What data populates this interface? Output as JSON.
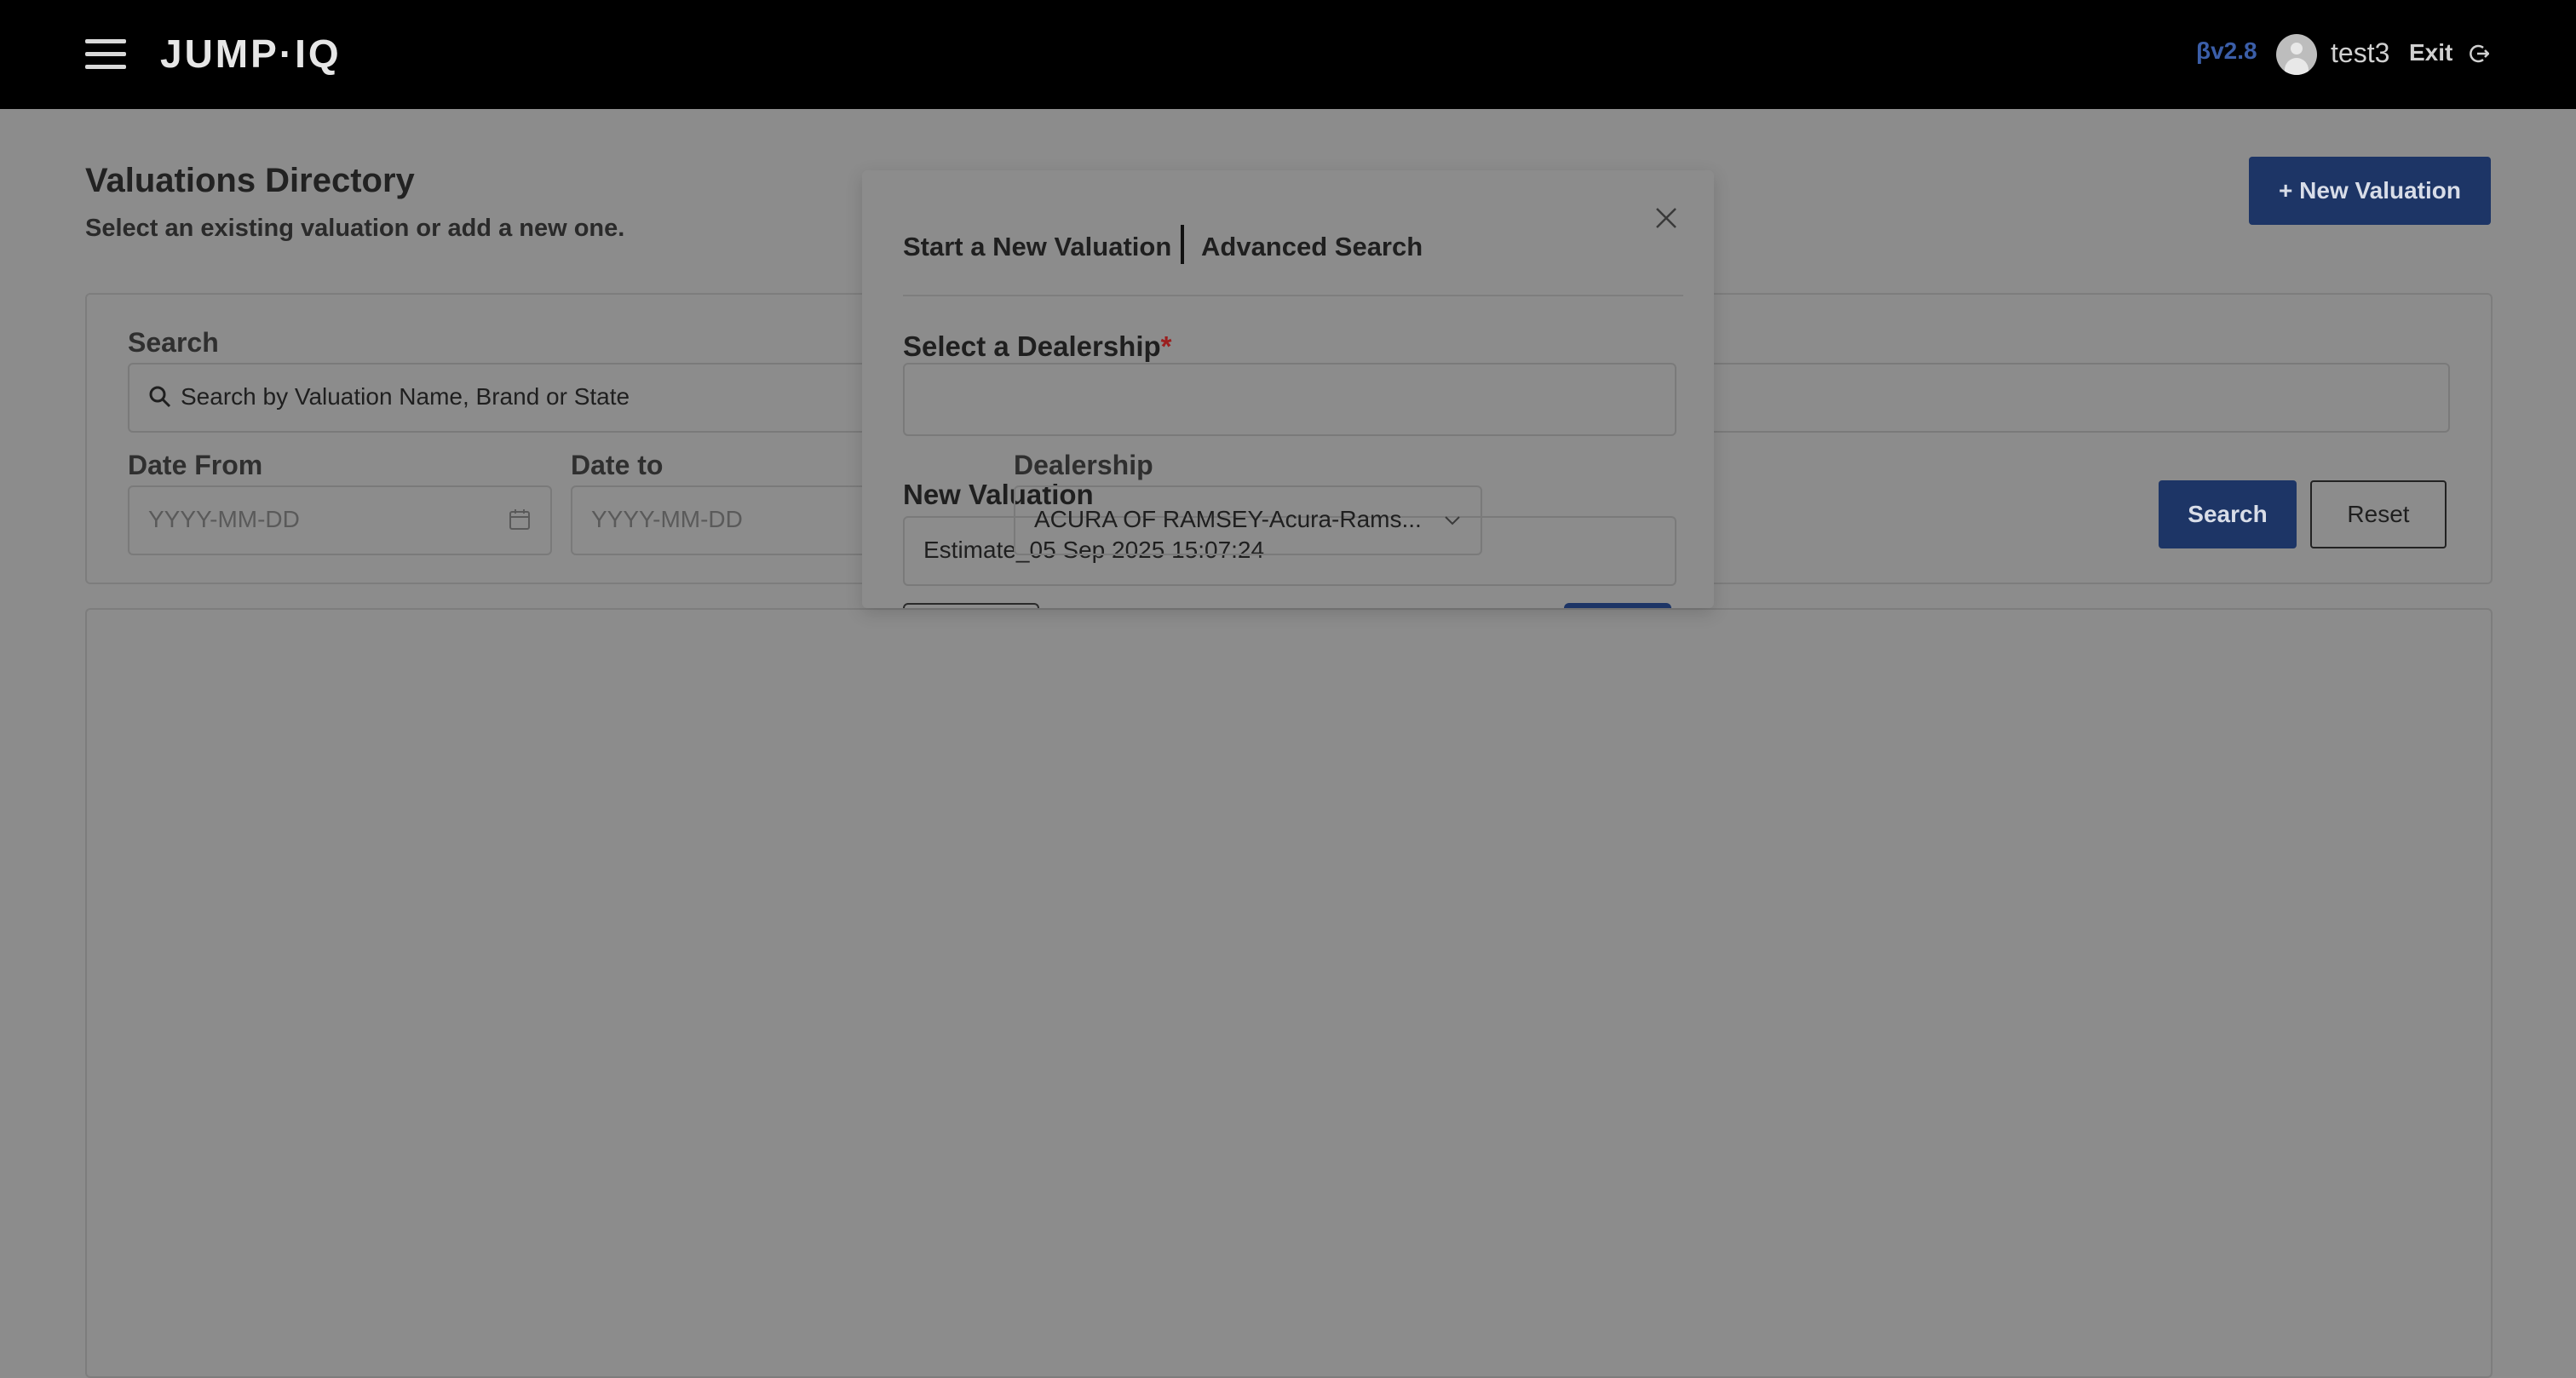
{
  "app": {
    "logo": "JUMP·IQ",
    "version": "βv2.8",
    "user": "test3",
    "exit_label": "Exit",
    "accent_color": "#1d3566"
  },
  "page": {
    "title": "Valuations Directory",
    "subtitle": "Select an existing valuation or add a new one.",
    "new_valuation_label": "+ New Valuation"
  },
  "search": {
    "label": "Search",
    "placeholder": "Search by Valuation Name, Brand or State",
    "date_from_label": "Date From",
    "date_from_placeholder": "YYYY-MM-DD",
    "date_to_label": "Date to",
    "date_to_placeholder": "YYYY-MM-DD",
    "dealership_label": "Dealership",
    "dealership_value": "ACURA OF RAMSEY-Acura-Rams...",
    "search_button": "Search",
    "reset_button": "Reset"
  },
  "modal": {
    "tab_new": "Start a New Valuation",
    "tab_advanced": "Advanced Search",
    "select_dealership_label": "Select a Dealership",
    "required_mark": "*",
    "new_valuation_label": "New Valuation",
    "new_valuation_value": "Estimate_05 Sep 2025 15:07:24"
  }
}
